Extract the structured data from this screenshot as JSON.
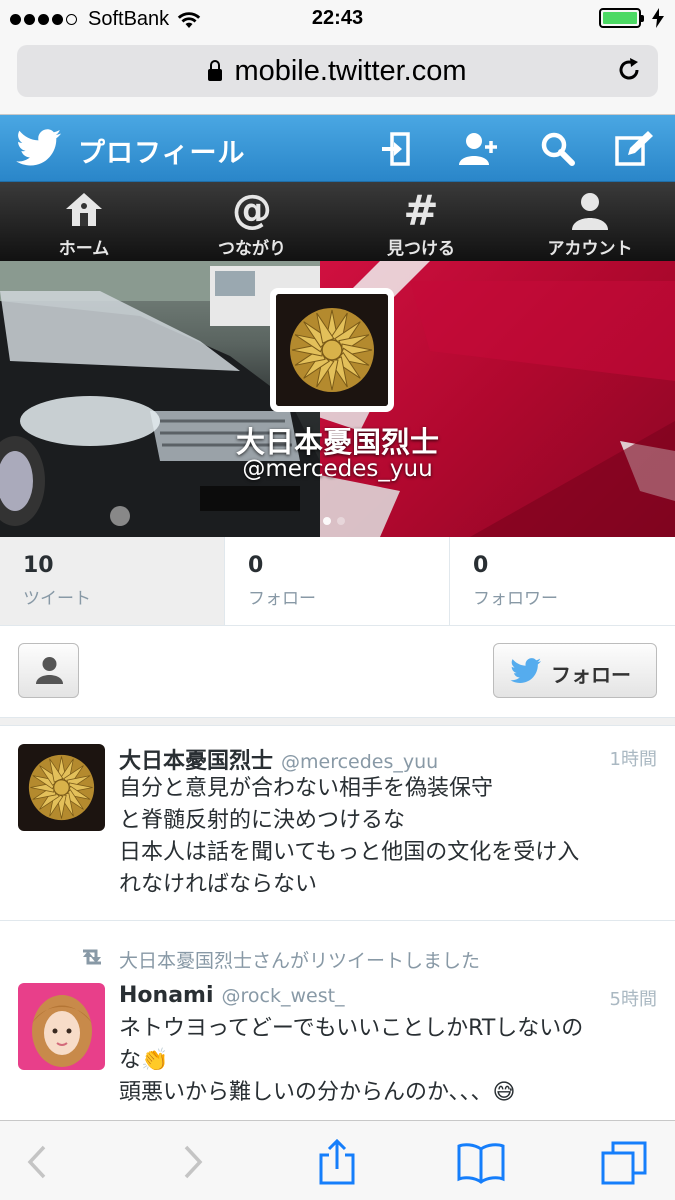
{
  "status_bar": {
    "carrier": "SoftBank",
    "time": "22:43"
  },
  "browser": {
    "url": "mobile.twitter.com"
  },
  "header": {
    "title": "プロフィール"
  },
  "nav": {
    "items": [
      {
        "label": "ホーム",
        "icon": "home-icon"
      },
      {
        "label": "つながり",
        "icon": "at-icon"
      },
      {
        "label": "見つける",
        "icon": "hashtag-icon"
      },
      {
        "label": "アカウント",
        "icon": "account-icon"
      }
    ]
  },
  "profile": {
    "name": "大日本憂国烈士",
    "handle": "@mercedes_yuu"
  },
  "stats": [
    {
      "value": "10",
      "label": "ツイート"
    },
    {
      "value": "0",
      "label": "フォロー"
    },
    {
      "value": "0",
      "label": "フォロワー"
    }
  ],
  "actions": {
    "follow_label": "フォロー"
  },
  "tweets": [
    {
      "name": "大日本憂国烈士",
      "handle": "@mercedes_yuu",
      "time": "1時間",
      "lines": [
        "自分と意見が合わない相手を偽装保守",
        "と脊髄反射的に決めつけるな",
        "日本人は話を聞いてもっと他国の文化を受け入",
        "れなければならない"
      ]
    },
    {
      "retweet_note": "大日本憂国烈士さんがリツイートしました",
      "name": "Honami",
      "handle": "@rock_west_",
      "time": "5時間",
      "lines": [
        "ネトウヨってどーでもいいことしかRTしないの",
        "な👏",
        "頭悪いから難しいの分からんのか、、、😅"
      ]
    }
  ],
  "colors": {
    "twitter_blue": "#3b97d8",
    "twitter_bird": "#55acee",
    "battery_green": "#4cd964",
    "safari_blue": "#157efb"
  }
}
